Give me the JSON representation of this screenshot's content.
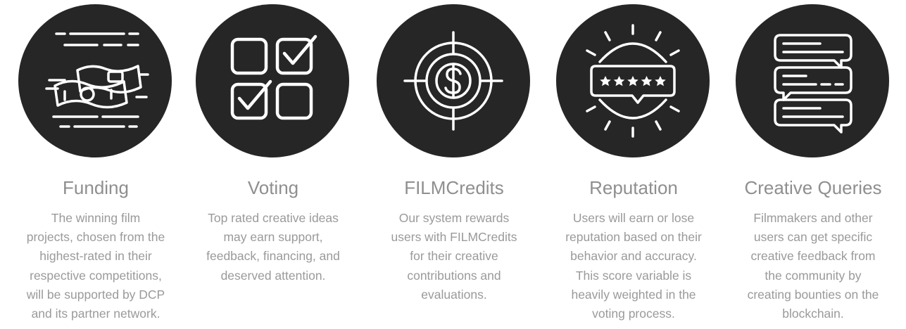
{
  "features": [
    {
      "icon": "money-bills-icon",
      "title": "Funding",
      "lines": [
        "The winning film",
        "projects, chosen from the",
        "highest-rated in their",
        "respective competitions,",
        "will be supported by DCP",
        "and its partner network."
      ]
    },
    {
      "icon": "checkbox-grid-icon",
      "title": "Voting",
      "lines": [
        "Top rated creative ideas",
        "may earn support,",
        "feedback, financing, and",
        "deserved attention."
      ]
    },
    {
      "icon": "dollar-target-icon",
      "title": "FILMCredits",
      "lines": [
        "Our system rewards",
        "users with FILMCredits",
        "for their creative",
        "contributions and",
        "evaluations."
      ]
    },
    {
      "icon": "five-star-rating-icon",
      "title": "Reputation",
      "lines": [
        "Users will earn or lose",
        "reputation based on their",
        "behavior and accuracy.",
        "This score variable is",
        "heavily weighted in the",
        "voting process."
      ]
    },
    {
      "icon": "chat-bubbles-icon",
      "title": "Creative Queries",
      "lines": [
        "Filmmakers and other",
        "users can get specific",
        "creative feedback from",
        "the community by",
        "creating bounties on the",
        "blockchain."
      ]
    }
  ],
  "colors": {
    "circle": "#262626",
    "icon": "#ffffff",
    "title": "#8f8f8f",
    "text": "#9a9a9a"
  }
}
